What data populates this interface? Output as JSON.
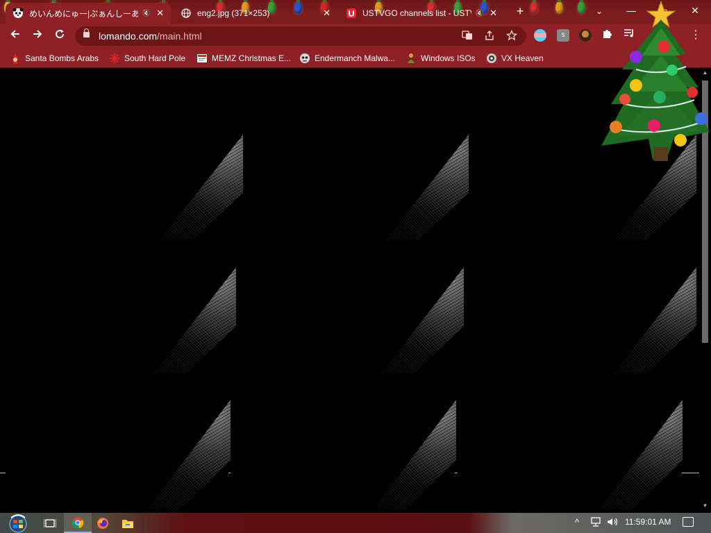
{
  "tabs": [
    {
      "title": "めいんめにゅー|ぶぁんしーあいらん",
      "icon": "panda-avatar-icon",
      "muted": "🔇",
      "close": "✕"
    },
    {
      "title": "eng2.jpg (371×253)",
      "icon": "globe-icon",
      "close": "✕"
    },
    {
      "title": "USTVGO channels list - USTV",
      "icon": "ustvgo-logo-icon",
      "muted": "🔇",
      "close": "✕"
    }
  ],
  "address": {
    "host": "lomando.com",
    "path": "/main.html"
  },
  "bookmarks": [
    {
      "label": "Santa Bombs Arabs",
      "icon": "santa-icon"
    },
    {
      "label": "South Hard Pole",
      "icon": "snowflake-icon"
    },
    {
      "label": "MEMZ Christmas E...",
      "icon": "memz-icon"
    },
    {
      "label": "Endermanch Malwa...",
      "icon": "enderman-icon"
    },
    {
      "label": "Windows ISOs",
      "icon": "windows-isos-icon"
    },
    {
      "label": "VX Heaven",
      "icon": "vx-heaven-icon"
    }
  ],
  "system": {
    "clock": "11:59:01 AM"
  },
  "colors": {
    "frame": "#8d2125",
    "tabstrip": "#7d1c1f",
    "omnibox": "#6e1518",
    "content_bg": "#000000"
  }
}
